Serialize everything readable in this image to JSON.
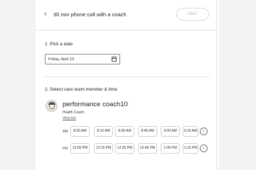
{
  "header": {
    "back_icon": "‹",
    "title": "30 min phone call with a coach",
    "next_label": "Next"
  },
  "steps": {
    "date": {
      "label": "1. Pick a date",
      "value": "Friday, April 19",
      "icon": "calendar-icon"
    },
    "member": {
      "label": "2. Select care team member & time"
    }
  },
  "coach": {
    "name": "performance coach10",
    "role": "Health Coach",
    "bio_link": "View bio",
    "am_label": "AM",
    "pm_label": "PM",
    "am_slots": [
      "8:00 AM",
      "8:15 AM",
      "8:30 AM",
      "8:45 AM",
      "9:00 AM",
      "9:15 AM"
    ],
    "pm_slots": [
      "12:00 PM",
      "12:15 PM",
      "12:30 PM",
      "12:45 PM",
      "1:00 PM",
      "1:15 PM"
    ],
    "more_icon": "›"
  },
  "colors": {
    "page_background": "#ffffff",
    "outer_background": "#f3f3f3",
    "next_button_text": "#b9b9b9"
  }
}
